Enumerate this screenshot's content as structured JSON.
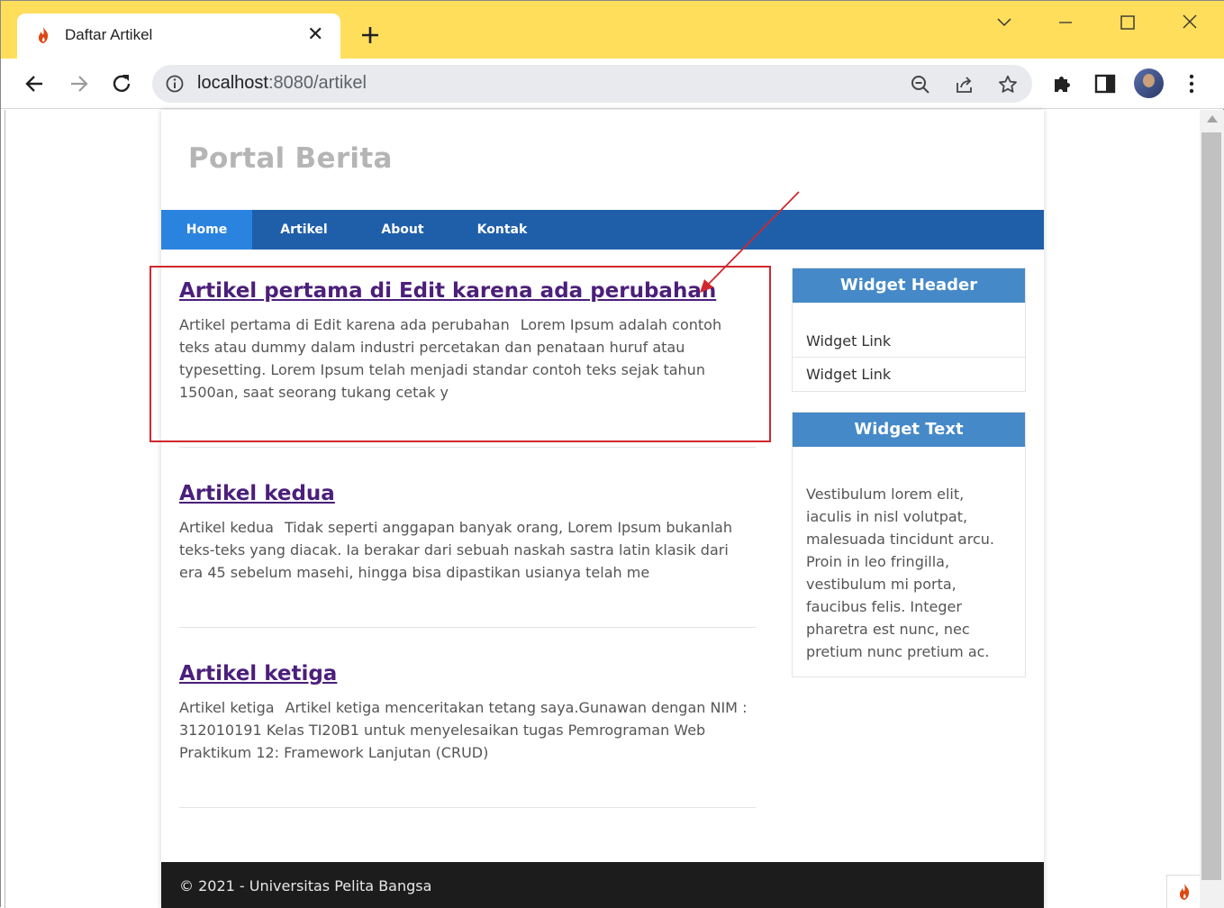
{
  "browser": {
    "tab_title": "Daftar Artikel",
    "url_host": "localhost",
    "url_path": ":8080/artikel"
  },
  "site": {
    "title": "Portal Berita",
    "nav": [
      {
        "label": "Home",
        "active": true
      },
      {
        "label": "Artikel",
        "active": false
      },
      {
        "label": "About",
        "active": false
      },
      {
        "label": "Kontak",
        "active": false
      }
    ]
  },
  "articles": [
    {
      "title": "Artikel pertama di Edit karena ada perubahan",
      "image_alt": "Artikel pertama di Edit karena ada perubahan",
      "excerpt": "Lorem Ipsum adalah contoh teks atau dummy dalam industri percetakan dan penataan huruf atau typesetting. Lorem Ipsum telah menjadi standar contoh teks sejak tahun 1500an, saat seorang tukang cetak y"
    },
    {
      "title": "Artikel kedua",
      "image_alt": "Artikel kedua",
      "excerpt": "Tidak seperti anggapan banyak orang, Lorem Ipsum bukanlah teks-teks yang diacak. Ia berakar dari sebuah naskah sastra latin klasik dari era 45 sebelum masehi, hingga bisa dipastikan usianya telah me"
    },
    {
      "title": "Artikel ketiga",
      "image_alt": "Artikel ketiga",
      "excerpt": "Artikel ketiga menceritakan tetang saya.Gunawan dengan NIM : 312010191 Kelas TI20B1 untuk menyelesaikan tugas Pemrograman Web Praktikum 12: Framework Lanjutan (CRUD)"
    }
  ],
  "widgets": {
    "header_title": "Widget Header",
    "links": [
      "Widget Link",
      "Widget Link"
    ],
    "text_title": "Widget Text",
    "text_body": "Vestibulum lorem elit, iaculis in nisl volutpat, malesuada tincidunt arcu. Proin in leo fringilla, vestibulum mi porta, faucibus felis. Integer pharetra est nunc, nec pretium nunc pretium ac."
  },
  "footer": {
    "text": "© 2021 - Universitas Pelita Bangsa"
  },
  "colors": {
    "tabstrip": "#ffde5c",
    "nav": "#1f5faa",
    "nav_active": "#2b83e0",
    "widget_header": "#4589c8",
    "article_link": "#4b1f7a",
    "annotation": "#d0282e",
    "footer": "#1c1c1c"
  },
  "icons": {
    "favicon": "codeigniter-flame-icon",
    "close": "close-icon",
    "new_tab": "plus-icon",
    "back": "back-arrow-icon",
    "forward": "forward-arrow-icon",
    "reload": "reload-icon",
    "info": "info-icon",
    "zoom": "zoom-out-icon",
    "share": "share-icon",
    "bookmark": "star-icon",
    "extensions": "puzzle-icon",
    "sidepanel": "side-panel-icon",
    "menu": "kebab-menu-icon"
  }
}
